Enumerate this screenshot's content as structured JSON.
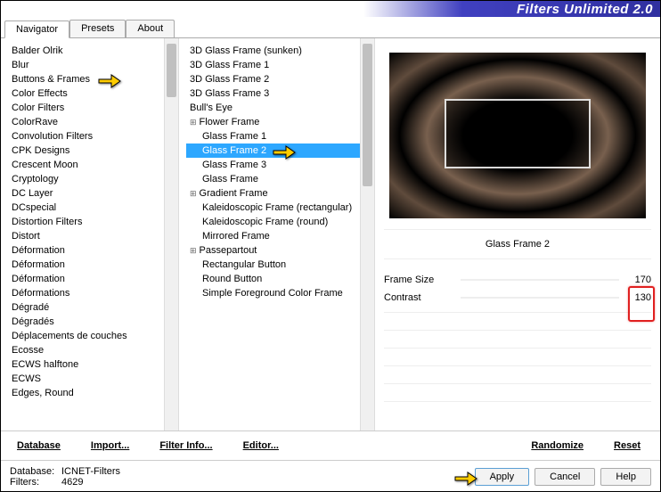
{
  "title": "Filters Unlimited 2.0",
  "tabs": [
    "Navigator",
    "Presets",
    "About"
  ],
  "active_tab": 0,
  "col1": {
    "items": [
      "Balder Olrik",
      "Blur",
      "Buttons & Frames",
      "Color Effects",
      "Color Filters",
      "ColorRave",
      "Convolution Filters",
      "CPK Designs",
      "Crescent Moon",
      "Cryptology",
      "DC Layer",
      "DCspecial",
      "Distortion Filters",
      "Distort",
      "Déformation",
      "Déformation",
      "Déformation",
      "Déformations",
      "Dégradé",
      "Dégradés",
      "Déplacements de couches",
      "Ecosse",
      "ECWS halftone",
      "ECWS",
      "Edges, Round"
    ],
    "selected_index": 2
  },
  "col2": {
    "items": [
      {
        "label": "3D Glass Frame (sunken)",
        "indent": false,
        "exp": false
      },
      {
        "label": "3D Glass Frame 1",
        "indent": false,
        "exp": false
      },
      {
        "label": "3D Glass Frame 2",
        "indent": false,
        "exp": false
      },
      {
        "label": "3D Glass Frame 3",
        "indent": false,
        "exp": false
      },
      {
        "label": "Bull's Eye",
        "indent": false,
        "exp": false
      },
      {
        "label": "Flower Frame",
        "indent": false,
        "exp": true
      },
      {
        "label": "Glass Frame 1",
        "indent": true,
        "exp": false
      },
      {
        "label": "Glass Frame 2",
        "indent": true,
        "exp": false
      },
      {
        "label": "Glass Frame 3",
        "indent": true,
        "exp": false
      },
      {
        "label": "Glass Frame",
        "indent": true,
        "exp": false
      },
      {
        "label": "Gradient Frame",
        "indent": false,
        "exp": true
      },
      {
        "label": "Kaleidoscopic Frame (rectangular)",
        "indent": true,
        "exp": false
      },
      {
        "label": "Kaleidoscopic Frame (round)",
        "indent": true,
        "exp": false
      },
      {
        "label": "Mirrored Frame",
        "indent": true,
        "exp": false
      },
      {
        "label": "Passepartout",
        "indent": false,
        "exp": true
      },
      {
        "label": "Rectangular Button",
        "indent": true,
        "exp": false
      },
      {
        "label": "Round Button",
        "indent": true,
        "exp": false
      },
      {
        "label": "Simple Foreground Color Frame",
        "indent": true,
        "exp": false
      }
    ],
    "selected_index": 7
  },
  "filter_name": "Glass Frame 2",
  "sliders": [
    {
      "label": "Frame Size",
      "value": "170"
    },
    {
      "label": "Contrast",
      "value": "130"
    }
  ],
  "bottom_links": {
    "database": "Database",
    "import": "Import...",
    "filterinfo": "Filter Info...",
    "editor": "Editor...",
    "randomize": "Randomize",
    "reset": "Reset"
  },
  "footer": {
    "db_label": "Database:",
    "db_value": "ICNET-Filters",
    "filters_label": "Filters:",
    "filters_value": "4629"
  },
  "buttons": {
    "apply": "Apply",
    "cancel": "Cancel",
    "help": "Help"
  }
}
